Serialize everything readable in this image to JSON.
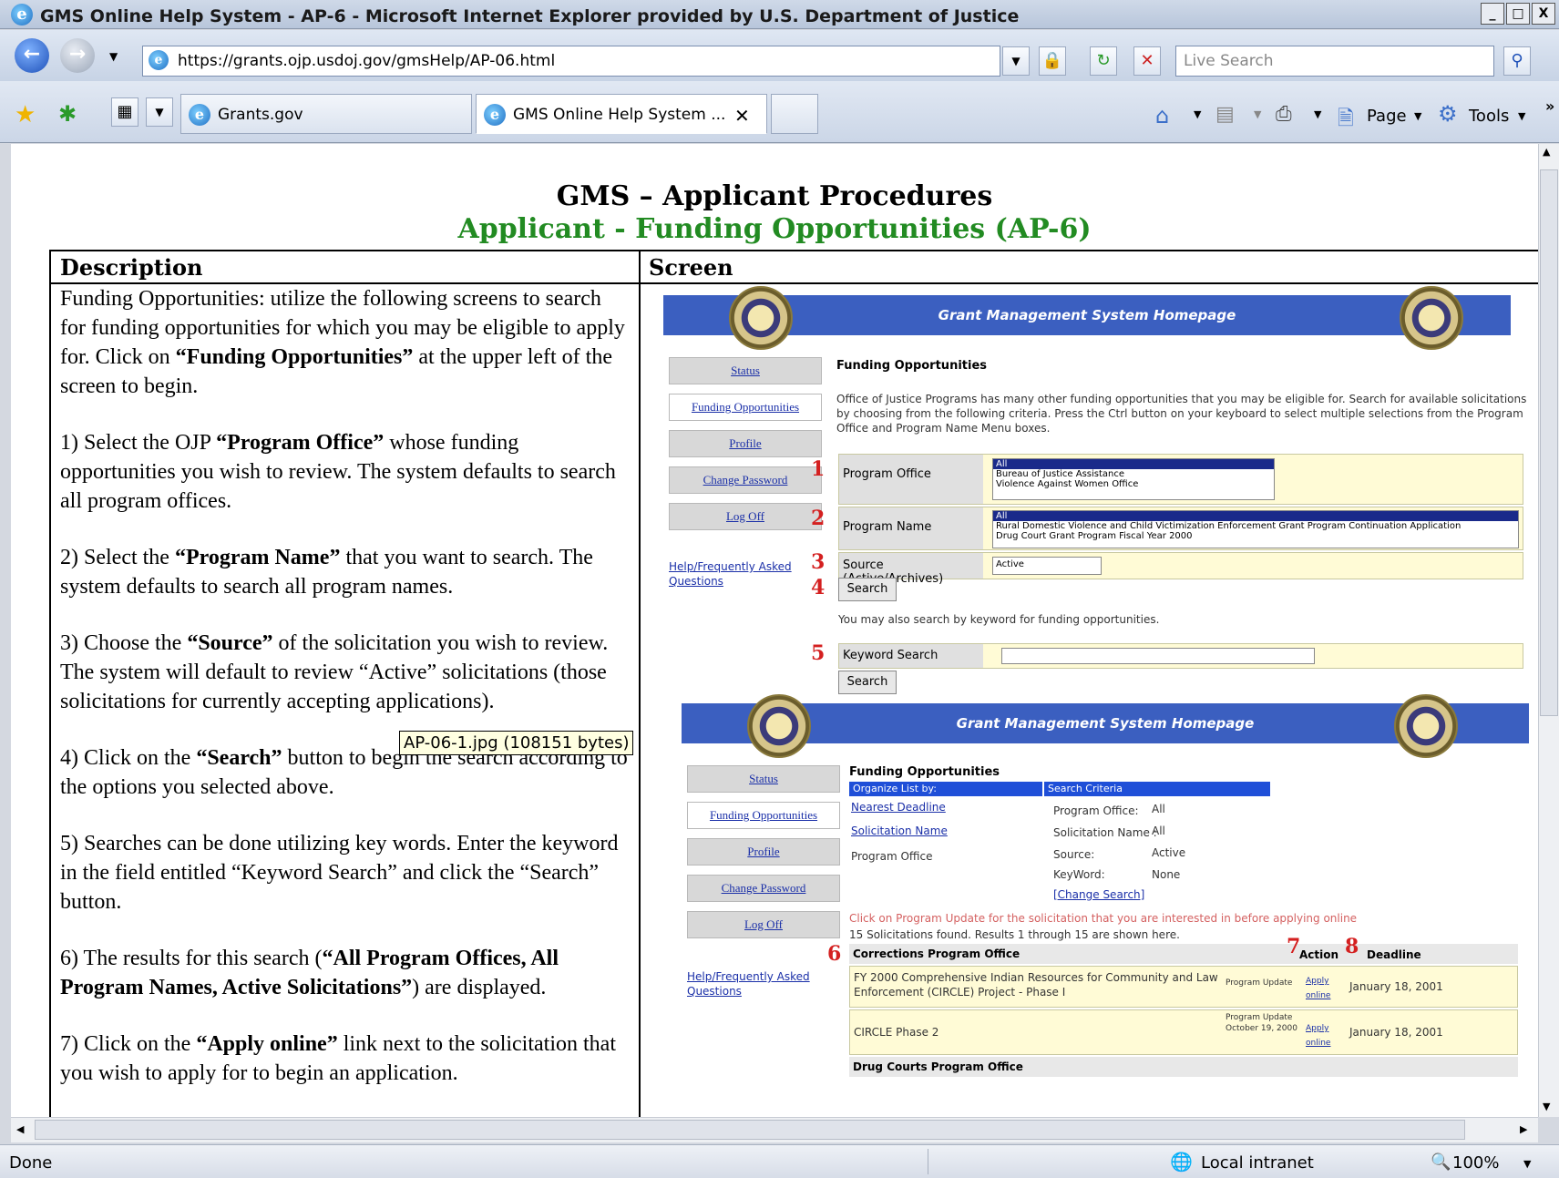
{
  "window": {
    "title": "GMS Online Help System - AP-6 - Microsoft Internet Explorer provided by U.S. Department of Justice",
    "buttons": [
      "_",
      "□",
      "X"
    ]
  },
  "navbar": {
    "url": "https://grants.ojp.usdoj.gov/gmsHelp/AP-06.html",
    "search_placeholder": "Live Search"
  },
  "tabs": [
    {
      "label": "Grants.gov"
    },
    {
      "label": "GMS Online Help System ..."
    }
  ],
  "commandbar": {
    "page": "Page",
    "tools": "Tools"
  },
  "document": {
    "title": "GMS – Applicant Procedures",
    "subtitle": "Applicant - Funding Opportunities (AP-6)",
    "col_description": "Description",
    "col_screen": "Screen",
    "paragraphs": [
      [
        "Funding Opportunities: utilize the following screens to search for funding opportunities for which you may be eligible to apply for.  Click on ",
        "“Funding Opportunities”",
        " at the upper left of the screen to begin."
      ],
      [
        "1) Select the OJP ",
        "“Program Office”",
        " whose funding opportunities you wish to review.  The system defaults to search all program offices."
      ],
      [
        "2) Select the ",
        "“Program Name”",
        " that you want to search.  The system defaults to search all program names."
      ],
      [
        "3) Choose the ",
        "“Source”",
        " of the solicitation you wish to review.  The system will default to review “Active” solicitations (those solicitations for",
        "",
        " currently accepting applications)."
      ],
      [
        "4) Click on the ",
        "“Search”",
        " button to begin the search according to the options you selected above."
      ],
      [
        "5) Searches can be done utilizing key words.  Enter the keyword in the field entitled “Keyword Search” and click the “Search” button."
      ],
      [
        "6) The results for this search (",
        "“All Program Offices, All Program Names, Active Solicitations”",
        ") are displayed."
      ],
      [
        "7) Click on the ",
        "“Apply online”",
        " link next to the solicitation that you wish to apply for to begin an application."
      ]
    ],
    "tooltip": "AP-06-1.jpg (108151 bytes)"
  },
  "screen1": {
    "banner": "Grant Management System Homepage",
    "nav": [
      "Status",
      "Funding Opportunities",
      "Profile",
      "Change Password",
      "Log Off"
    ],
    "help_link": "Help/Frequently Asked Questions",
    "heading": "Funding Opportunities",
    "intro": "Office of Justice Programs has many other funding opportunities that you may be eligible for. Search for available solicitations by choosing from the following criteria. Press the Ctrl button on your keyboard to select multiple selections from the Program Office and Program Name Menu boxes.",
    "program_office_label": "Program Office",
    "program_office_options": [
      "All",
      "Bureau of Justice Assistance",
      "Violence Against Women Office"
    ],
    "program_name_label": "Program Name",
    "program_name_options": [
      "All",
      "Rural Domestic Violence and Child Victimization Enforcement Grant Program Continuation Application",
      "Drug Court Grant Program Fiscal Year 2000"
    ],
    "source_label": "Source (Active/Archives)",
    "source_value": "Active",
    "search_button": "Search",
    "keyword_hint": "You may also search by keyword for funding opportunities.",
    "keyword_label": "Keyword Search",
    "numbers": [
      "1",
      "2",
      "3",
      "4",
      "5"
    ]
  },
  "screen2": {
    "banner": "Grant Management System Homepage",
    "nav": [
      "Status",
      "Funding Opportunities",
      "Profile",
      "Change Password",
      "Log Off"
    ],
    "help_link": "Help/Frequently Asked Questions",
    "heading": "Funding Opportunities",
    "organize_by": "Organize List by:",
    "search_criteria": "Search Criteria",
    "sort_links": [
      "Nearest Deadline",
      "Solicitation Name",
      "Program Office"
    ],
    "criteria": [
      {
        "k": "Program Office:",
        "v": "All"
      },
      {
        "k": "Solicitation Name :",
        "v": "All"
      },
      {
        "k": "Source:",
        "v": "Active"
      },
      {
        "k": "KeyWord:",
        "v": "None"
      }
    ],
    "change_search": "[Change Search]",
    "click_note": "Click on Program Update for the solicitation that you are interested in before applying online",
    "results_note": "15 Solicitations found. Results 1 through 15 are shown here.",
    "office1": "Corrections Program Office",
    "col_action": "Action",
    "col_deadline": "Deadline",
    "rows": [
      {
        "name": "FY 2000 Comprehensive Indian Resources for Community and Law Enforcement (CIRCLE) Project - Phase I",
        "update": "Program Update",
        "apply": "Apply online",
        "deadline": "January 18, 2001"
      },
      {
        "name": "CIRCLE Phase 2",
        "update": "Program Update October 19, 2000",
        "apply": "Apply online",
        "deadline": "January 18, 2001"
      }
    ],
    "office2": "Drug Courts Program Office",
    "numbers": [
      "6",
      "7",
      "8"
    ]
  },
  "statusbar": {
    "left": "Done",
    "zone": "Local intranet",
    "zoom": "100%"
  }
}
